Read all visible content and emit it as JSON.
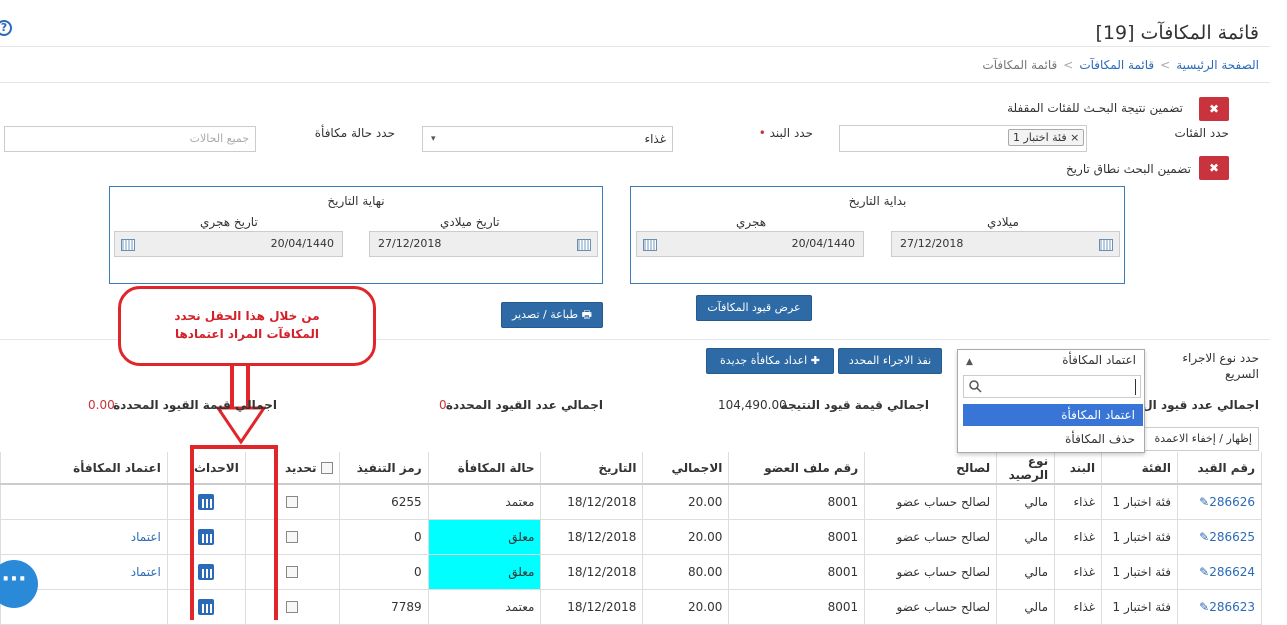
{
  "page": {
    "title": "قائمة المكافآت [19]",
    "help_icon": "?"
  },
  "breadcrumb": {
    "home": "الصفحة الرئيسية",
    "list": "قائمة المكافآت",
    "current": "قائمة المكافآت",
    "sep": ">"
  },
  "filters": {
    "include_locked_label": "تضمين نتيجة البحـث للفئات المقفلة",
    "categories_label": "حدد الفئات",
    "category_tag": "فئة اختبار 1",
    "tag_remove": "×",
    "item_label": "حدد البند",
    "item_required": "•",
    "item_value": "غذاء",
    "status_label": "حدد حالة مكافأة",
    "status_placeholder": "جميع الحالات",
    "include_date_label": "تضمين البحث نطاق تاريخ",
    "toggle_x": "✖"
  },
  "date_start": {
    "title": "بداية التاريخ",
    "gregorian_label": "ميلادي",
    "hijri_label": "هجري",
    "gregorian_value": "27/12/2018",
    "hijri_value": "20/04/1440"
  },
  "date_end": {
    "title": "نهاية التاريخ",
    "gregorian_label": "تاريخ ميلادي",
    "hijri_label": "تاريخ هجري",
    "gregorian_value": "27/12/2018",
    "hijri_value": "20/04/1440"
  },
  "buttons": {
    "show_entries": "عرض قيود المكافآت",
    "print_export": "طباعة / تصدير",
    "print_icon": "🖶",
    "execute": "نفذ الاجراء المحدد",
    "new_reward": "اعداد مكافأة جديدة",
    "plus_icon": "✚"
  },
  "callout": {
    "line1": "من خلال هذا الحقل نحدد",
    "line2": "المكافآت المراد اعتمادها"
  },
  "quick_action": {
    "label_line1": "حدد نوع الاجراء",
    "label_line2": "السريع",
    "selected": "اعتماد المكافأة",
    "search_icon": "search-icon",
    "options": [
      "اعتماد المكافأة",
      "حذف المكافأة"
    ],
    "caret": "▲"
  },
  "totals": {
    "result_count_label": "اجمالي عدد قيود ال",
    "result_value_label": "اجمالي قيمة قيود النتيجة",
    "result_value": "104,490.00",
    "selected_count_label": "اجمالي عدد القيود المحددة",
    "selected_count": "0",
    "selected_value_label": "اجمالي قيمة القيود المحددة",
    "selected_value": "0.00"
  },
  "show_hide_columns": "إظهار / إخفاء الاعمدة",
  "table": {
    "headers": [
      "رقم القيد",
      "الفئة",
      "البند",
      "نوع الرصيد",
      "لصالح",
      "رقم ملف العضو",
      "الاجمالي",
      "التاريخ",
      "حالة المكافأة",
      "رمز التنفيذ",
      "تحديد",
      "الاحداث",
      "اعتماد المكافأة"
    ],
    "rows": [
      {
        "id": "286626",
        "category": "فئة اختبار 1",
        "item": "غذاء",
        "balance": "مالي",
        "for": "لصالح حساب عضو",
        "member": "8001",
        "total": "20.00",
        "date": "18/12/2018",
        "status": "معتمد",
        "code": "6255",
        "approve": ""
      },
      {
        "id": "286625",
        "category": "فئة اختبار 1",
        "item": "غذاء",
        "balance": "مالي",
        "for": "لصالح حساب عضو",
        "member": "8001",
        "total": "20.00",
        "date": "18/12/2018",
        "status": "معلق",
        "code": "0",
        "approve": "اعتماد"
      },
      {
        "id": "286624",
        "category": "فئة اختبار 1",
        "item": "غذاء",
        "balance": "مالي",
        "for": "لصالح حساب عضو",
        "member": "8001",
        "total": "80.00",
        "date": "18/12/2018",
        "status": "معلق",
        "code": "0",
        "approve": "اعتماد"
      },
      {
        "id": "286623",
        "category": "فئة اختبار 1",
        "item": "غذاء",
        "balance": "مالي",
        "for": "لصالح حساب عضو",
        "member": "8001",
        "total": "20.00",
        "date": "18/12/2018",
        "status": "معتمد",
        "code": "7789",
        "approve": ""
      }
    ]
  },
  "chat_icon": "···",
  "colors": {
    "accent": "#2d6aa6",
    "highlight": "#00ffff",
    "alert": "#e0262a"
  }
}
